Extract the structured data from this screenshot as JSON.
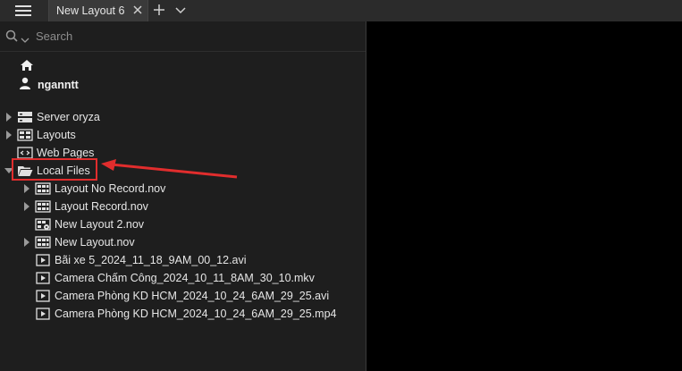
{
  "tabs": [
    {
      "label": "New Layout 6"
    }
  ],
  "search": {
    "placeholder": "Search"
  },
  "user": {
    "name": "nganntt"
  },
  "tree": [
    {
      "label": "Server oryza",
      "icon": "server-icon",
      "expand": "collapsed"
    },
    {
      "label": "Layouts",
      "icon": "layouts-icon",
      "expand": "collapsed"
    },
    {
      "label": "Web Pages",
      "icon": "webpage-icon",
      "expand": "none"
    },
    {
      "label": "Local Files",
      "icon": "folder-open-icon",
      "expand": "expanded"
    },
    {
      "label": "Layout No Record.nov",
      "icon": "layout-grid-icon",
      "expand": "collapsed"
    },
    {
      "label": "Layout Record.nov",
      "icon": "layout-grid-icon",
      "expand": "collapsed"
    },
    {
      "label": "New Layout 2.nov",
      "icon": "layout-settings-icon",
      "expand": "none"
    },
    {
      "label": "New Layout.nov",
      "icon": "layout-grid-icon",
      "expand": "collapsed"
    },
    {
      "label": "Bãi xe 5_2024_11_18_9AM_00_12.avi",
      "icon": "video-play-icon",
      "expand": "none"
    },
    {
      "label": "Camera Chấm Công_2024_10_11_8AM_30_10.mkv",
      "icon": "video-play-icon",
      "expand": "none"
    },
    {
      "label": "Camera Phòng KD HCM_2024_10_24_6AM_29_25.avi",
      "icon": "video-play-icon",
      "expand": "none"
    },
    {
      "label": "Camera Phòng KD HCM_2024_10_24_6AM_29_25.mp4",
      "icon": "video-play-icon",
      "expand": "none"
    }
  ],
  "colors": {
    "annotation": "#e12d2d",
    "background": "#1e1e1e",
    "viewport": "#000000"
  }
}
